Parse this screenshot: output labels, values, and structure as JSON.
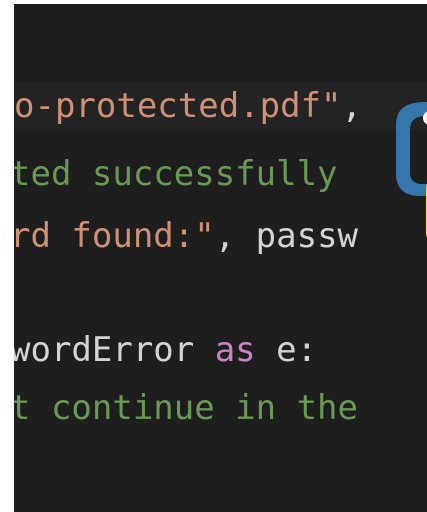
{
  "editor": {
    "lines": [
      {
        "string_text": "o-protected.pdf\"",
        "punct_text": ","
      },
      {
        "comment_text": "ted successfully"
      },
      {
        "string_text": "rd found:\"",
        "punct_text": ", ",
        "ident_text": "passw"
      },
      {
        "ident_text": "wordError ",
        "keyword_text": "as",
        "tail_text": " e:"
      },
      {
        "comment_text": "t continue in the"
      }
    ]
  },
  "logo": {
    "icon": "python-logo-icon",
    "colors": {
      "blue": "#3776ab",
      "yellow": "#ffd43b"
    }
  },
  "colors": {
    "background": "#1e1e1e",
    "string": "#ce9178",
    "comment": "#6a9955",
    "keyword": "#c586c0",
    "identifier": "#d4d4d4"
  }
}
